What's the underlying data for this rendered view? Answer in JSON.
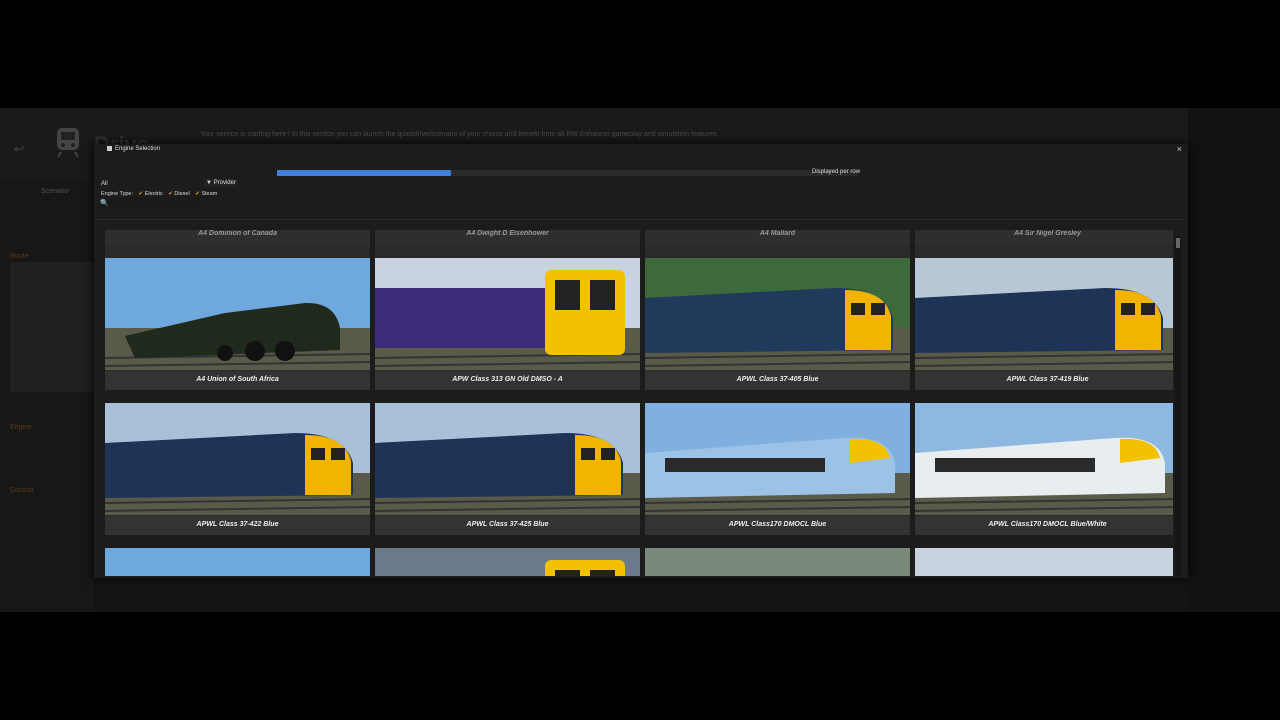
{
  "app": {
    "back_glyph": "↩",
    "logo_icon": "train-icon",
    "title": "Drive",
    "banner": "Your service is starting here ! In this section you can launch the quickdrive/scenario of your choice and benefit from all RW Enhancer gameplay and simulation features.",
    "sidebar": {
      "scenario_label": "Scenario",
      "route_label": "Route",
      "engine_label": "Engine",
      "consist_label": "Consist"
    }
  },
  "dialog": {
    "title": "Engine Selection",
    "close_glyph": "×",
    "progress_fraction": 0.3,
    "displayed_per_row_label": "Displayed per row",
    "filter_all": "All",
    "provider_label": "Provider",
    "engine_type_label": "Engine Type:",
    "engine_types": [
      {
        "label": "Electric",
        "checked": true
      },
      {
        "label": "Diesel",
        "checked": true
      },
      {
        "label": "Steam",
        "checked": true
      }
    ],
    "search_placeholder": ""
  },
  "cards_top_partial": [
    {
      "label": "A4 Dominion of Canada"
    },
    {
      "label": "A4 Dwight D Eisenhower"
    },
    {
      "label": "A4 Mallard"
    },
    {
      "label": "A4 Sir Nigel Gresley"
    }
  ],
  "cards": [
    {
      "label": "A4 Union of South Africa",
      "scheme": "steam",
      "body": "#1f2a1d",
      "sky": "#6fa8dc"
    },
    {
      "label": "APW Class 313 GN Old DMSO - A",
      "scheme": "emu",
      "body": "#3b2b7a",
      "sky": "#c9d3e0"
    },
    {
      "label": "APWL Class 37-405 Blue",
      "scheme": "diesel",
      "body": "#1f3a5a",
      "sky": "#3c6a3c"
    },
    {
      "label": "APWL Class 37-419 Blue",
      "scheme": "diesel",
      "body": "#1e3456",
      "sky": "#b7c7d6"
    },
    {
      "label": "APWL Class 37-422 Blue",
      "scheme": "diesel",
      "body": "#1e3456",
      "sky": "#a9c1d8"
    },
    {
      "label": "APWL Class 37-425 Blue",
      "scheme": "diesel",
      "body": "#1e3456",
      "sky": "#a9c1d8"
    },
    {
      "label": "APWL Class170 DMOCL Blue",
      "scheme": "dmu",
      "body": "#9cc3e6",
      "sky": "#7fb0e0"
    },
    {
      "label": "APWL Class170 DMOCL Blue/White",
      "scheme": "dmu",
      "body": "#e8eef0",
      "sky": "#8fb8e0"
    }
  ],
  "cards_bottom_partial": [
    {
      "label": "",
      "scheme": "dmu",
      "body": "#2b4e8a",
      "sky": "#6fa8dc"
    },
    {
      "label": "",
      "scheme": "emu",
      "body": "#cfd8e3",
      "sky": "#6b7a8a"
    },
    {
      "label": "",
      "scheme": "diesel",
      "body": "#4b5a6a",
      "sky": "#7a8a7a"
    },
    {
      "label": "",
      "scheme": "diesel",
      "body": "#7a1a1a",
      "sky": "#c9d3e0"
    }
  ]
}
